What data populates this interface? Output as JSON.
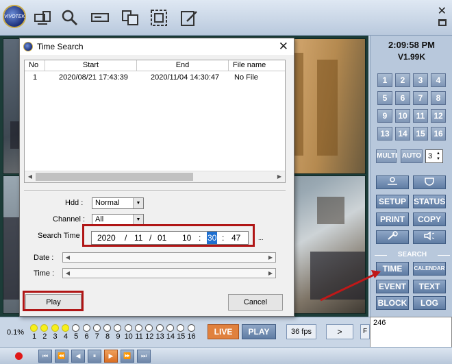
{
  "toolbar": {
    "logo_text": "VIVOTEK",
    "buttons": [
      "camera-settings-icon",
      "monitor-icon",
      "search-icon",
      "recorder-icon",
      "folder-icon",
      "grid-icon",
      "edit-icon"
    ]
  },
  "window": {
    "close": "✕"
  },
  "right_panel": {
    "time": "2:09:58 PM",
    "version": "V1.99K",
    "channels": [
      "1",
      "2",
      "3",
      "4",
      "5",
      "6",
      "7",
      "8",
      "9",
      "10",
      "11",
      "12",
      "13",
      "14",
      "15",
      "16"
    ],
    "multi": "MULTI",
    "auto": "AUTO",
    "auto_value": "3",
    "buttons_row1": [
      "SETUP",
      "STATUS"
    ],
    "buttons_row2": [
      "PRINT",
      "COPY"
    ],
    "search_label": "SEARCH",
    "search_buttons": [
      "TIME",
      "CALENDAR",
      "EVENT",
      "TEXT",
      "BLOCK",
      "LOG"
    ]
  },
  "info_box": "246",
  "bottom": {
    "percent": "0.1%",
    "channel_numbers": [
      "1",
      "2",
      "3",
      "4",
      "5",
      "6",
      "7",
      "8",
      "9",
      "10",
      "11",
      "12",
      "13",
      "14",
      "15",
      "16"
    ],
    "active_channels": [
      1,
      2,
      3,
      4
    ],
    "live": "LIVE",
    "play": "PLAY",
    "fps": "36 fps",
    "next": ">",
    "edge": "F"
  },
  "playback": {
    "buttons": [
      "⏮",
      "⏪",
      "◀",
      "⏸",
      "▶",
      "⏩",
      "⏭"
    ],
    "active_index": 4
  },
  "dialog": {
    "title": "Time Search",
    "close": "✕",
    "columns": [
      "No",
      "Start",
      "End",
      "File name"
    ],
    "rows": [
      {
        "no": "1",
        "start": "2020/08/21  17:43:39",
        "end": "2020/11/04  14:30:47",
        "file": "No File"
      }
    ],
    "hdd_label": "Hdd :",
    "hdd_value": "Normal",
    "channel_label": "Channel :",
    "channel_value": "All",
    "search_time_label": "Search Time",
    "search_time": {
      "year": "2020",
      "month": "11",
      "day": "01",
      "hour": "10",
      "minute": "30",
      "second": "47"
    },
    "ellipsis": "...",
    "date_label": "Date :",
    "time_label": "Time :",
    "play_button": "Play",
    "cancel_button": "Cancel"
  }
}
